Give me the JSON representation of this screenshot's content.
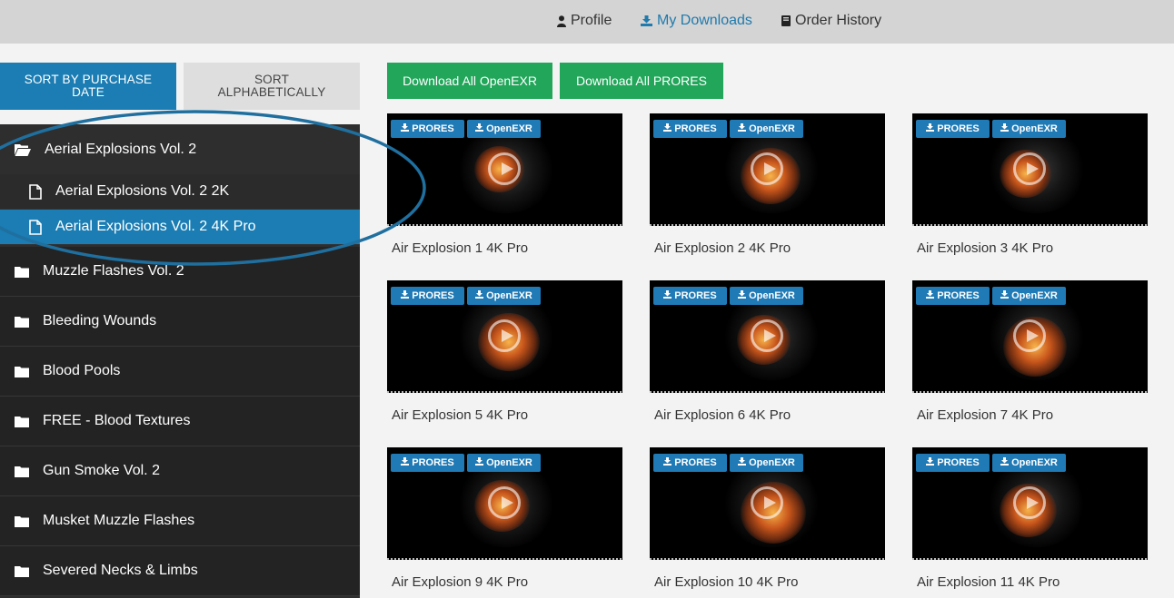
{
  "nav": {
    "profile": "Profile",
    "downloads": "My Downloads",
    "orders": "Order History"
  },
  "sort": {
    "by_date": "SORT BY PURCHASE DATE",
    "alphabetical": "SORT ALPHABETICALLY"
  },
  "sidebar": {
    "expanded_folder": "Aerial Explosions Vol. 2",
    "files": [
      "Aerial Explosions Vol. 2 2K",
      "Aerial Explosions Vol. 2 4K Pro"
    ],
    "selected_file": "Aerial Explosions Vol. 2 4K Pro",
    "folders": [
      "Muzzle Flashes Vol. 2",
      "Bleeding Wounds",
      "Blood Pools",
      "FREE - Blood Textures",
      "Gun Smoke Vol. 2",
      "Musket Muzzle Flashes",
      "Severed Necks & Limbs"
    ]
  },
  "downloads": {
    "openexr": "Download All OpenEXR",
    "prores": "Download All PRORES"
  },
  "badges": {
    "prores": "PRORES",
    "openexr": "OpenEXR"
  },
  "grid": [
    "Air Explosion 1 4K Pro",
    "Air Explosion 2 4K Pro",
    "Air Explosion 3 4K Pro",
    "Air Explosion 5 4K Pro",
    "Air Explosion 6 4K Pro",
    "Air Explosion 7 4K Pro",
    "Air Explosion 9 4K Pro",
    "Air Explosion 10 4K Pro",
    "Air Explosion 11 4K Pro"
  ],
  "colors": {
    "accent": "#1b7db3",
    "green": "#21a65a",
    "sidebar": "#2e2e2e",
    "annotation": "#1f6f9f"
  },
  "icons": {
    "profile": "user-icon",
    "downloads": "download-icon",
    "orders": "document-icon",
    "folder_open": "folder-open-icon",
    "folder": "folder-icon",
    "file": "file-icon"
  }
}
